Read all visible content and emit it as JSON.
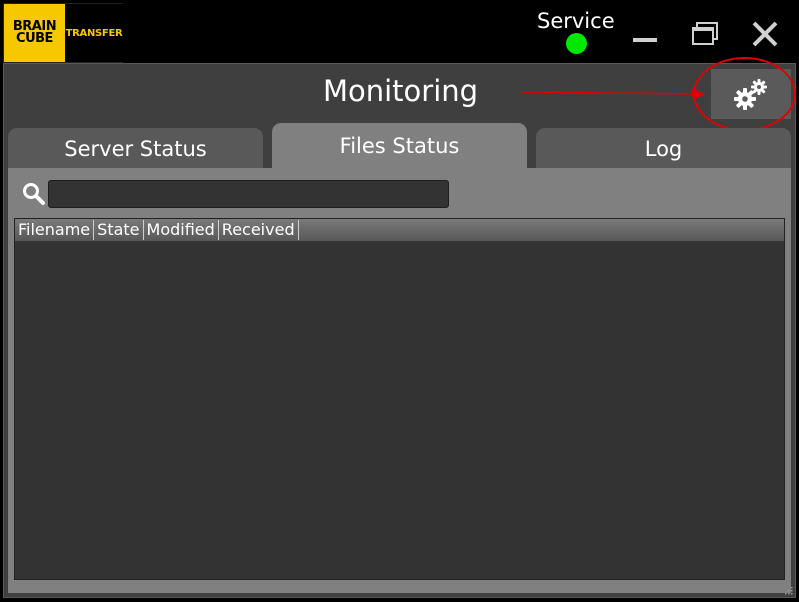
{
  "logo": {
    "line1": "BRAIN",
    "line2": "CUBE",
    "product": "TRANSFER"
  },
  "service": {
    "label": "Service",
    "status_color": "#00e800"
  },
  "window_controls": {
    "minimize_icon": "minimize-icon",
    "maximize_icon": "maximize-icon",
    "close_icon": "close-icon"
  },
  "header": {
    "title": "Monitoring",
    "settings_icon": "gears-icon"
  },
  "tabs": [
    {
      "label": "Server Status",
      "active": false
    },
    {
      "label": "Files Status",
      "active": true
    },
    {
      "label": "Log",
      "active": false
    }
  ],
  "search": {
    "value": "",
    "placeholder": ""
  },
  "table": {
    "columns": [
      "Filename",
      "State",
      "Modified",
      "Received"
    ],
    "rows": []
  },
  "colors": {
    "accent": "#f5c800",
    "annotation": "#e00000"
  }
}
